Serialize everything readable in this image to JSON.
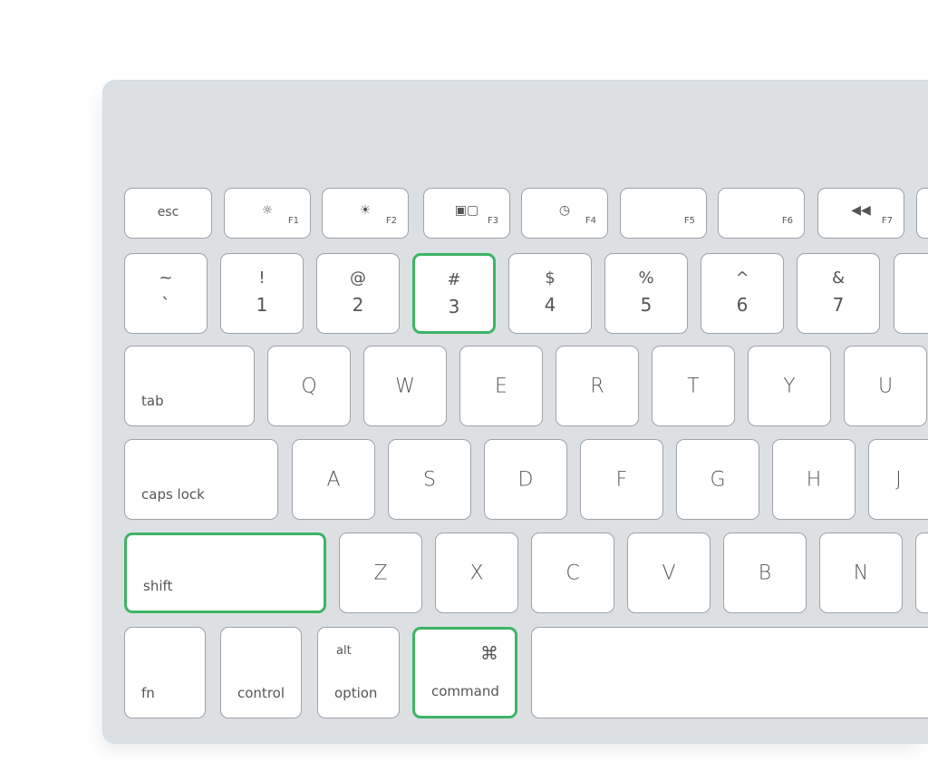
{
  "colors": {
    "body": "#dde0e3",
    "key": "#ffffff",
    "key_border": "#9ea3a8",
    "highlight": "#3db465",
    "text": "#555555"
  },
  "rows": [
    {
      "name": "function-row",
      "keys": [
        {
          "id": "esc",
          "main": "esc"
        },
        {
          "id": "f1",
          "icon": "☼",
          "fn": "F1",
          "icon_name": "brightness-down-icon"
        },
        {
          "id": "f2",
          "icon": "☀",
          "fn": "F2",
          "icon_name": "brightness-up-icon"
        },
        {
          "id": "f3",
          "icon": "▣▢",
          "fn": "F3",
          "icon_name": "expose-icon"
        },
        {
          "id": "f4",
          "icon": "◷",
          "fn": "F4",
          "icon_name": "dashboard-icon"
        },
        {
          "id": "f5",
          "fn": "F5"
        },
        {
          "id": "f6",
          "fn": "F6"
        },
        {
          "id": "f7",
          "icon": "◀◀",
          "fn": "F7",
          "icon_name": "rewind-icon"
        },
        {
          "id": "f8"
        }
      ]
    },
    {
      "name": "number-row",
      "keys": [
        {
          "id": "tilde",
          "top": "~",
          "bottom": "`"
        },
        {
          "id": "1",
          "top": "!",
          "bottom": "1"
        },
        {
          "id": "2",
          "top": "@",
          "bottom": "2"
        },
        {
          "id": "3",
          "top": "#",
          "bottom": "3",
          "highlighted": true
        },
        {
          "id": "4",
          "top": "$",
          "bottom": "4"
        },
        {
          "id": "5",
          "top": "%",
          "bottom": "5"
        },
        {
          "id": "6",
          "top": "^",
          "bottom": "6"
        },
        {
          "id": "7",
          "top": "&",
          "bottom": "7"
        },
        {
          "id": "8"
        }
      ]
    },
    {
      "name": "qwerty-row",
      "keys": [
        {
          "id": "tab",
          "small": "tab"
        },
        {
          "id": "q",
          "main": "Q"
        },
        {
          "id": "w",
          "main": "W"
        },
        {
          "id": "e",
          "main": "E"
        },
        {
          "id": "r",
          "main": "R"
        },
        {
          "id": "t",
          "main": "T"
        },
        {
          "id": "y",
          "main": "Y"
        },
        {
          "id": "u",
          "main": "U"
        }
      ]
    },
    {
      "name": "home-row",
      "keys": [
        {
          "id": "caps-lock",
          "small": "caps lock"
        },
        {
          "id": "a",
          "main": "A"
        },
        {
          "id": "s",
          "main": "S"
        },
        {
          "id": "d",
          "main": "D"
        },
        {
          "id": "f",
          "main": "F"
        },
        {
          "id": "g",
          "main": "G"
        },
        {
          "id": "h",
          "main": "H"
        },
        {
          "id": "j",
          "main": "J"
        }
      ]
    },
    {
      "name": "bottom-letter-row",
      "keys": [
        {
          "id": "shift",
          "small": "shift",
          "highlighted": true
        },
        {
          "id": "z",
          "main": "Z"
        },
        {
          "id": "x",
          "main": "X"
        },
        {
          "id": "c",
          "main": "C"
        },
        {
          "id": "v",
          "main": "V"
        },
        {
          "id": "b",
          "main": "B"
        },
        {
          "id": "n",
          "main": "N"
        },
        {
          "id": "m"
        }
      ]
    },
    {
      "name": "modifier-row",
      "keys": [
        {
          "id": "fn",
          "small": "fn"
        },
        {
          "id": "control",
          "small": "control"
        },
        {
          "id": "option",
          "alt": "alt",
          "small": "option"
        },
        {
          "id": "command",
          "cmd": "⌘",
          "small": "command",
          "highlighted": true
        },
        {
          "id": "space"
        }
      ]
    }
  ]
}
